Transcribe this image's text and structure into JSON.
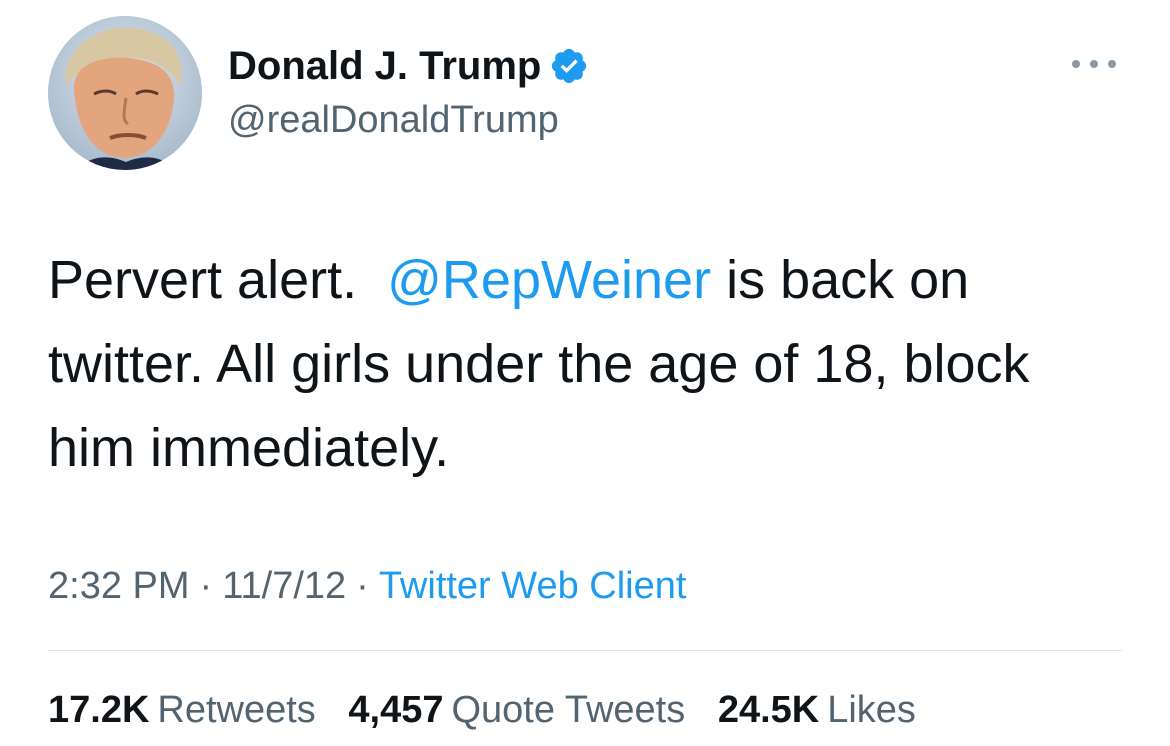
{
  "author": {
    "display_name": "Donald J. Trump",
    "handle": "@realDonaldTrump",
    "verified": true,
    "avatar_icon": "profile-photo"
  },
  "menu": {
    "icon": "more-options-icon"
  },
  "tweet": {
    "text_before": "Pervert alert.  ",
    "mention": "@RepWeiner",
    "text_after": " is back on twitter. All girls under the age of 18, block him immediately."
  },
  "meta": {
    "time": "2:32 PM",
    "separator": "·",
    "date": "11/7/12",
    "source": "Twitter Web Client"
  },
  "stats": {
    "retweets_count": "17.2K",
    "retweets_label": "Retweets",
    "quotes_count": "4,457",
    "quotes_label": "Quote Tweets",
    "likes_count": "24.5K",
    "likes_label": "Likes"
  },
  "colors": {
    "link": "#1d9bf0",
    "secondary_text": "#536471",
    "primary_text": "#0f1419",
    "divider": "#e1e4e8"
  }
}
